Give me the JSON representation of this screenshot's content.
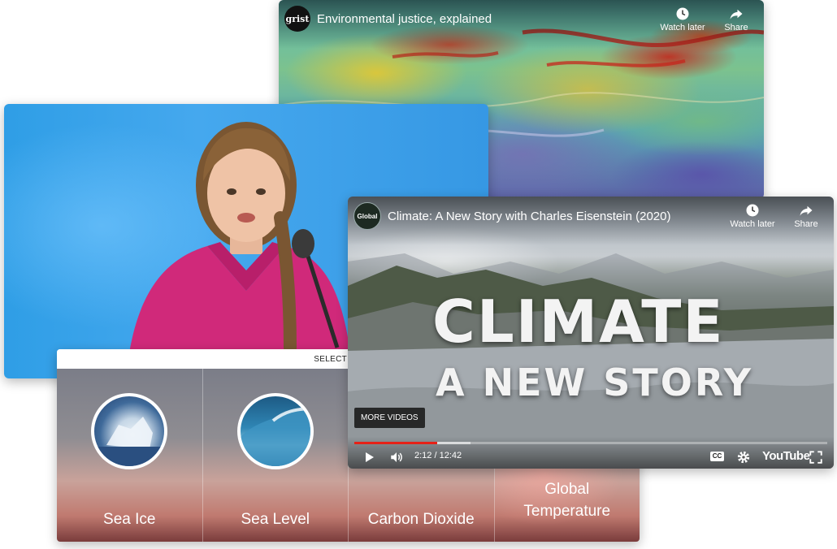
{
  "grist_video": {
    "logo_text": "grist",
    "title": "Environmental justice, explained",
    "watch_later_label": "Watch later",
    "share_label": "Share"
  },
  "climate_video": {
    "logo_text": "Global",
    "title": "Climate: A New Story with Charles Eisenstein (2020)",
    "watch_later_label": "Watch later",
    "share_label": "Share",
    "overlay_line1": "CLIMATE",
    "overlay_line2": "A NEW STORY",
    "more_videos_label": "MORE VIDEOS",
    "time_display": "2:12 / 12:42",
    "progress": 0.175,
    "cc_label": "CC",
    "youtube_label": "YouTube"
  },
  "selector": {
    "header_label": "SELECT",
    "options": [
      {
        "label": "Sea Ice"
      },
      {
        "label": "Sea Level"
      },
      {
        "label": "Carbon Dioxide"
      },
      {
        "label": "Global Temperature"
      }
    ]
  },
  "icons": {
    "watch_later": "clock-icon",
    "share": "share-arrow-icon",
    "play": "play-icon",
    "volume": "volume-icon",
    "captions": "captions-icon",
    "settings": "gear-icon",
    "fullscreen": "fullscreen-icon"
  },
  "colors": {
    "progress_played": "#e62117",
    "speech_background": "#2f9ee6",
    "shirt": "#d0297a"
  }
}
